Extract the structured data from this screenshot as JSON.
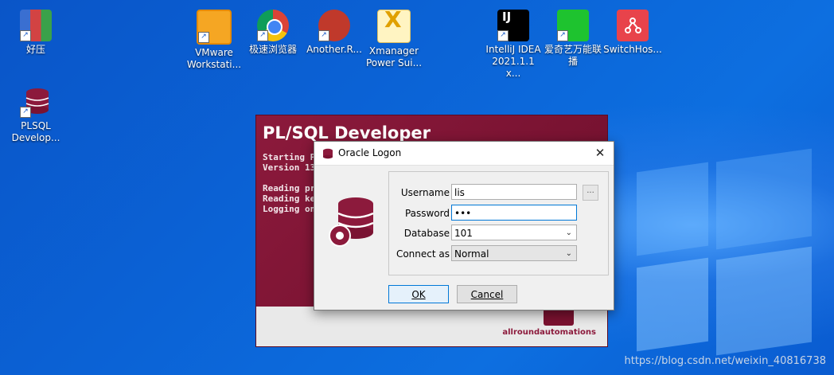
{
  "desktop": {
    "icons": [
      {
        "label": "好压",
        "icon": "archive-icon"
      },
      {
        "label": "PLSQL Develop...",
        "icon": "database-icon"
      },
      {
        "label": "VMware Workstati...",
        "icon": "vmware-icon"
      },
      {
        "label": "极速浏览器",
        "icon": "browser-icon"
      },
      {
        "label": "Another.R...",
        "icon": "redis-icon"
      },
      {
        "label": "Xmanager Power Sui...",
        "icon": "xmanager-icon"
      },
      {
        "label": "IntelliJ IDEA 2021.1.1 x...",
        "icon": "intellij-icon"
      },
      {
        "label": "爱奇艺万能联播",
        "icon": "iqiyi-icon"
      },
      {
        "label": "SwitchHos...",
        "icon": "switchhosts-icon"
      }
    ],
    "watermark": "https://blog.csdn.net/weixin_40816738"
  },
  "splash": {
    "title": "PL/SQL Developer",
    "info": "Starting Pl\nVersion 13\n\nReading pr\nReading ke\nLogging on",
    "brand": "allroundautomations"
  },
  "dialog": {
    "title": "Oracle Logon",
    "close": "✕",
    "username_label": "Username",
    "username_value": "lis",
    "password_label": "Password",
    "password_value": "•••",
    "database_label": "Database",
    "database_value": "101",
    "connect_as_label": "Connect as",
    "connect_as_value": "Normal",
    "ellipsis": "...",
    "ok_label": "OK",
    "cancel_label": "Cancel"
  },
  "colors": {
    "accent": "#0078d7",
    "plsql_brand": "#8c1a3c"
  }
}
